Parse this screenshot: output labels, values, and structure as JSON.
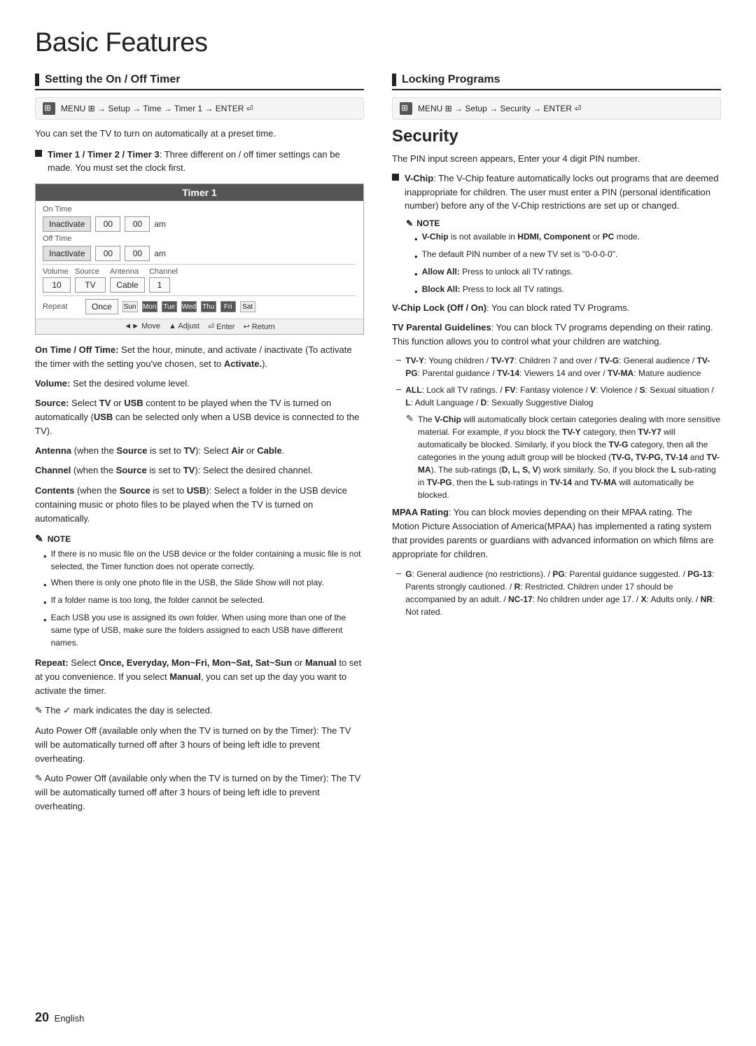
{
  "page": {
    "title": "Basic Features",
    "number": "20",
    "language": "English"
  },
  "left_section": {
    "heading": "Setting the On / Off Timer",
    "menu_path": "MENU ⊞ → Setup → Time → Timer 1 → ENTER ⏎",
    "intro": "You can set the TV to turn on automatically at a preset time.",
    "bullet1_label": "Timer 1 / Timer 2 / Timer 3",
    "bullet1_text": ": Three different on / off timer settings can be made. You must set the clock first.",
    "timer": {
      "title": "Timer 1",
      "on_time_label": "On Time",
      "off_time_label": "Off Time",
      "inactivate": "Inactivate",
      "time_00a": "00",
      "time_00b": "00",
      "time_00c": "00",
      "time_00d": "00",
      "am_label": "am",
      "volume_label": "Volume",
      "source_label": "Source",
      "antenna_label": "Antenna",
      "channel_label": "Channel",
      "volume_val": "10",
      "source_val": "TV",
      "antenna_val": "Cable",
      "channel_val": "1",
      "repeat_label": "Repeat",
      "repeat_val": "Once",
      "days": [
        "Sun",
        "Mon",
        "Tue",
        "Wed",
        "Thu",
        "Fri",
        "Sat"
      ],
      "nav_move": "◄► Move",
      "nav_adjust": "▲ Adjust",
      "nav_enter": "⏎ Enter",
      "nav_return": "↩ Return"
    },
    "on_off_time_text": "On Time / Off Time: Set the hour, minute, and activate / inactivate (To activate the timer with the setting you’ve chosen, set to Activate.).",
    "volume_text": "Volume: Set the desired volume level.",
    "source_text": "Source: Select TV or USB content to be played when the TV is turned on automatically (USB can be selected only when a USB device is connected to the TV).",
    "antenna_text_label": "Antenna",
    "antenna_text": " (when the Source is set to TV): Select Air or Cable.",
    "channel_text_label": "Channel",
    "channel_text": " (when the Source is set to TV): Select the desired channel.",
    "contents_text_label": "Contents",
    "contents_text": " (when the Source is set to USB): Select a folder in the USB device containing music or photo files to be played when the TV is turned on automatically.",
    "note_label": "NOTE",
    "notes": [
      "If there is no music file on the USB device or the folder containing a music file is not selected, the Timer function does not operate correctly.",
      "When there is only one photo file in the USB, the Slide Show will not play.",
      "If a folder name is too long, the folder cannot be selected.",
      "Each USB you use is assigned its own folder. When using more than one of the same type of USB, make sure the folders assigned to each USB have different names."
    ],
    "repeat_text_label": "Repeat",
    "repeat_text": ": Select Once, Everyday, Mon~Fri, Mon~Sat, Sat~Sun or Manual to set at you convenience. If you select Manual, you can set up the day you want to activate the timer.",
    "checkmark_note": "The ✓ mark indicates the day is selected.",
    "auto_power_text": "Auto Power Off (available only when the TV is turned on by the Timer): The TV will be automatically turned off after 3 hours of being left idle to prevent overheating."
  },
  "right_section": {
    "heading": "Locking Programs",
    "menu_path": "MENU ⊞ → Setup → Security → ENTER ⏎",
    "security_heading": "Security",
    "security_intro": "The PIN input screen appears, Enter your 4 digit PIN number.",
    "vchip_label": "V-Chip",
    "vchip_text": ": The V-Chip feature automatically locks out programs that are deemed inappropriate for children. The user must enter a PIN (personal identification number) before any of the V-Chip restrictions are set up or changed.",
    "note_label": "NOTE",
    "notes_right": [
      "V-Chip is not available in HDMI, Component or PC mode.",
      "The default PIN number of a new TV set is “0-0-0-0”.",
      "Allow All: Press to unlock all TV ratings.",
      "Block All: Press to lock all TV ratings."
    ],
    "vchip_lock_label": "V-Chip Lock (Off / On)",
    "vchip_lock_text": ": You can block rated TV Programs.",
    "tv_parental_label": "TV Parental Guidelines",
    "tv_parental_text": ": You can block TV programs depending on their rating. This function allows you to control what your children are watching.",
    "dash_items": [
      "TV-Y: Young children / TV-Y7: Children 7 and over / TV-G: General audience / TV-PG: Parental guidance / TV-14: Viewers 14 and over / TV-MA: Mature audience",
      "ALL: Lock all TV ratings. / FV: Fantasy violence / V: Violence / S: Sexual situation / L: Adult Language / D: Sexually Suggestive Dialog"
    ],
    "vchip_auto_text": "The V-Chip will automatically block certain categories dealing with more sensitive material. For example, if you block the TV-Y category, then TV-Y7 will automatically be blocked. Similarly, if you block the TV-G category, then all the categories in the young adult group will be blocked (TV-G, TV-PG, TV-14 and TV-MA). The sub-ratings (D, L, S, V) work similarly. So, if you block the L sub-rating in TV-PG, then the L sub-ratings in TV-14 and TV-MA will automatically be blocked.",
    "mpaa_label": "MPAA Rating",
    "mpaa_text": ": You can block movies depending on their MPAA rating. The Motion Picture Association of America(MPAA) has implemented a rating system that provides parents or guardians with advanced information on which films are appropriate for children.",
    "mpaa_dash": "G: General audience (no restrictions). / PG: Parental guidance suggested. / PG-13: Parents strongly cautioned. / R: Restricted. Children under 17 should be accompanied by an adult. / NC-17: No children under age 17. / X: Adults only. / NR: Not rated."
  }
}
